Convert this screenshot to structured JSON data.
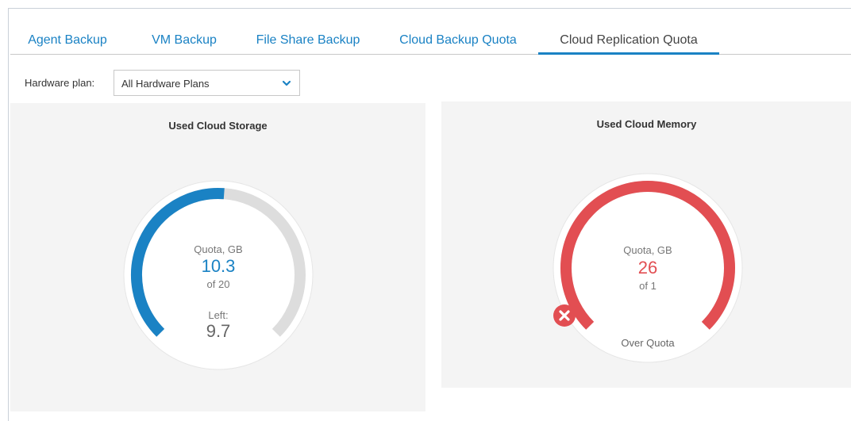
{
  "tabs": [
    {
      "label": "Agent Backup",
      "active": false
    },
    {
      "label": "VM Backup",
      "active": false
    },
    {
      "label": "File Share Backup",
      "active": false
    },
    {
      "label": "Cloud Backup Quota",
      "active": false
    },
    {
      "label": "Cloud Replication Quota",
      "active": true
    }
  ],
  "hardware_plan": {
    "label": "Hardware plan:",
    "selected": "All Hardware Plans",
    "icon": "chevron-down-icon"
  },
  "storage": {
    "title": "Used Cloud Storage",
    "quota_label": "Quota, GB",
    "used": "10.3",
    "of_text": "of 20",
    "left_label": "Left:",
    "left_value": "9.7",
    "used_fraction": 0.515,
    "color": "#1a82c4"
  },
  "memory": {
    "title": "Used Cloud Memory",
    "quota_label": "Quota, GB",
    "used": "26",
    "of_text": "of 1",
    "status": "Over Quota",
    "status_icon": "close-circle-icon",
    "used_fraction": 1,
    "color": "#e24e52"
  },
  "colors": {
    "accent": "#1a82c4",
    "danger": "#e24e52",
    "track": "#dddddd",
    "panel_bg": "#f4f4f4"
  }
}
